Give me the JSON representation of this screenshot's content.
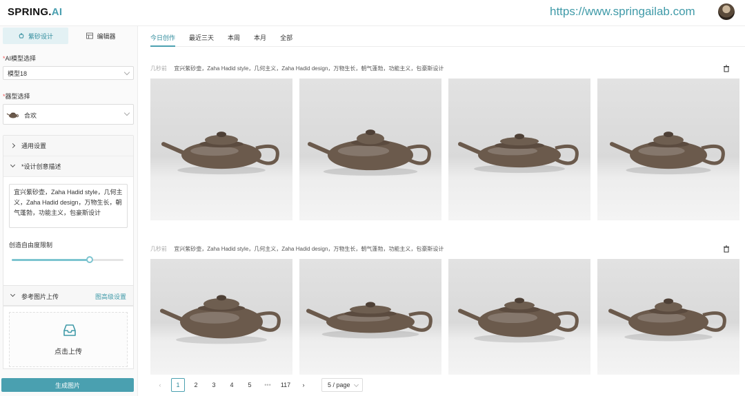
{
  "header": {
    "logo_main": "SPRING.",
    "logo_accent": "AI",
    "url": "https://www.springailab.com"
  },
  "sidebar": {
    "tabs": [
      {
        "label": "紫砂设计",
        "icon": "teapot-icon"
      },
      {
        "label": "编辑器",
        "icon": "editor-grid-icon"
      }
    ],
    "model_label": "AI模型选择",
    "model_value": "模型18",
    "shape_label": "器型选择",
    "shape_value": "合欢",
    "general_settings": "通用设置",
    "description_label": "*设计创意描述",
    "description_text": "宜兴紫砂壶，Zaha Hadid style，几何主义，Zaha Hadid design，万物生长，朝气蓬勃，功能主义，包豪斯设计",
    "freedom_label": "创造自由度限制",
    "freedom_value": 0.7,
    "reference_upload": "参考图片上传",
    "advanced_settings": "图高级设置",
    "upload_text": "点击上传",
    "generate_button": "生成图片"
  },
  "main": {
    "tabs": [
      "今日创作",
      "最近三天",
      "本周",
      "本月",
      "全部"
    ],
    "active_tab": 0,
    "groups": [
      {
        "tag": "几秒前",
        "prompt": "宜兴紫砂壶，Zaha Hadid style，几何主义，Zaha Hadid design，万物生长，朝气蓬勃，功能主义，包豪斯设计",
        "images": 4
      },
      {
        "tag": "几秒前",
        "prompt": "宜兴紫砂壶，Zaha Hadid style，几何主义，Zaha Hadid design，万物生长，朝气蓬勃，功能主义，包豪斯设计",
        "images": 4
      }
    ],
    "pagination": {
      "pages": [
        "1",
        "2",
        "3",
        "4",
        "5",
        "•••",
        "117"
      ],
      "current": "1",
      "page_size": "5 / page"
    }
  },
  "colors": {
    "accent": "#4aa0b0",
    "url": "#3f9aa8",
    "teapot_body": "#6b5a4c"
  }
}
